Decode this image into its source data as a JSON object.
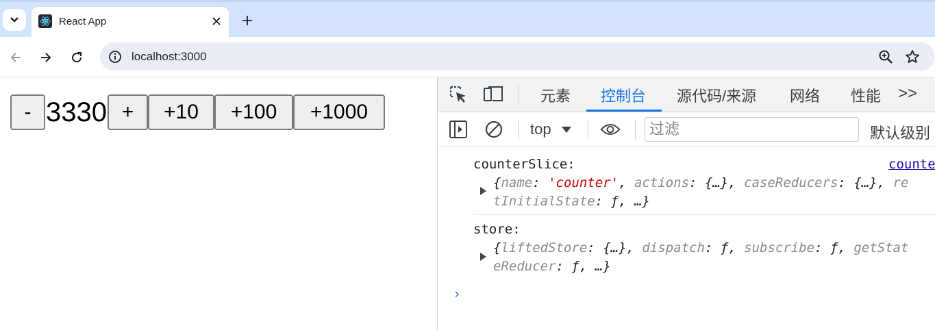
{
  "browser": {
    "tab_title": "React App",
    "url": "localhost:3000"
  },
  "counter": {
    "minus_label": "-",
    "value": "3330",
    "plus_label": "+",
    "plus10_label": "+10",
    "plus100_label": "+100",
    "plus1000_label": "+1000"
  },
  "devtools": {
    "tabs": [
      {
        "label": "元素"
      },
      {
        "label": "控制台"
      },
      {
        "label": "源代码/来源"
      },
      {
        "label": "网络"
      },
      {
        "label": "性能"
      }
    ],
    "more_label": ">>",
    "context": "top",
    "filter_placeholder": "过滤",
    "levels_label": "默认级别",
    "accent_color": "#1a73e8",
    "messages": [
      {
        "label": "counterSlice:",
        "link": "counte",
        "line1": {
          "k1": "name",
          "v1": "'counter'",
          "k2": "actions",
          "v2": "{…}",
          "k3": "caseReducers",
          "v3": "{…}",
          "tail": "re"
        },
        "line2": {
          "k": "tInitialState",
          "v": "ƒ",
          "rest": "…}"
        }
      },
      {
        "label": "store:",
        "line1": {
          "k1": "liftedStore",
          "v1": "{…}",
          "k2": "dispatch",
          "v2": "ƒ",
          "k3": "subscribe",
          "v3": "ƒ",
          "tail": "getStat"
        },
        "line2": {
          "k": "eReducer",
          "v": "ƒ",
          "rest": "…}"
        }
      }
    ],
    "prompt": "›"
  }
}
